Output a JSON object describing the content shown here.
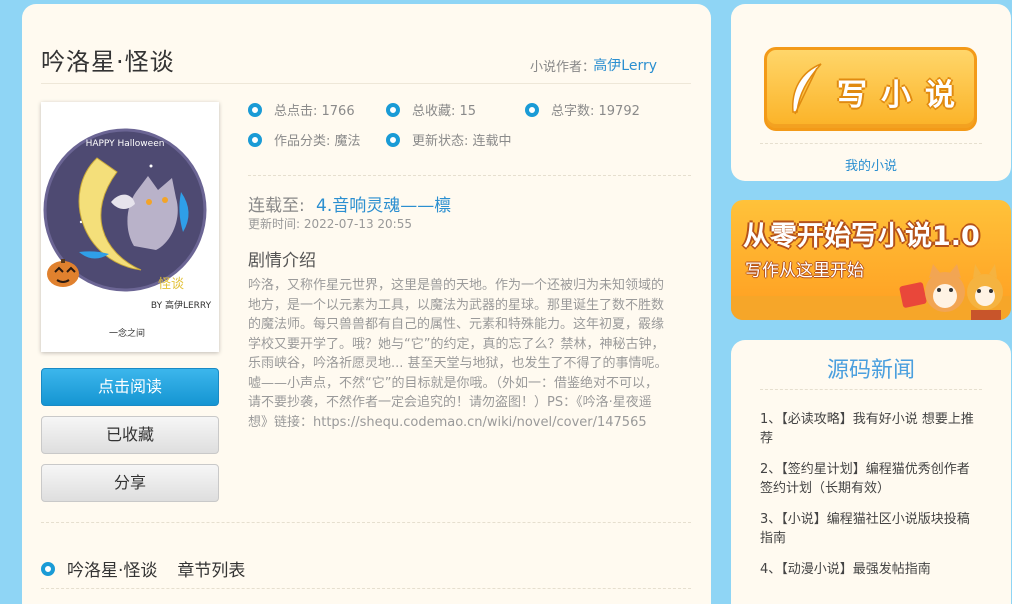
{
  "novel": {
    "title": "吟洛星·怪谈",
    "author_label": "小说作者：",
    "author_name": "高伊Lerry",
    "stats": {
      "clicks_label": "总点击: 1766",
      "favorites_label": "总收藏: 15",
      "words_label": "总字数: 19792",
      "category_label": "作品分类: 魔法",
      "status_label": "更新状态: 连载中"
    },
    "latest_label": "连载至:",
    "latest_chapter": "4.音响灵魂——檩",
    "update_time": "更新时间: 2022-07-13 20:55",
    "plot_heading": "剧情介绍",
    "plot_text": "吟洛，又称作星元世界，这里是兽的天地。作为一个还被归为未知领域的地方，是一个以元素为工具，以魔法为武器的星球。那里诞生了数不胜数的魔法师。每只兽兽都有自己的属性、元素和特殊能力。这年初夏，霰缘学校又要开学了。哦？她与“它”的约定，真的忘了么？禁林，神秘古钟，乐雨峡谷，吟洛祈愿灵地... 甚至天堂与地狱，也发生了不得了的事情呢。 嘘——小声点，不然“它”的目标就是你哦。（外如一：借鉴绝对不可以，请不要抄袭，不然作者一定会追究的！请勿盗图！）PS：《吟洛·星夜遥想》链接：https://shequ.codemao.cn/wiki/novel/cover/147565",
    "chapter_title": "吟洛星·怪谈",
    "chapter_list_label": "章节列表"
  },
  "cover": {
    "banner_text": "HAPPY Halloween",
    "title_text": "怪谈",
    "byline": "BY 高伊LERRY",
    "tagline": "一念之间"
  },
  "buttons": {
    "read": "点击阅读",
    "favorited": "已收藏",
    "share": "分享"
  },
  "sidebar": {
    "write_button": "写小说",
    "my_novels": "我的小说",
    "banner_title": "从零开始写小说1.0",
    "banner_subtitle": "写作从这里开始",
    "news_title": "源码新闻",
    "news": [
      "1、【必读攻略】我有好小说 想要上推荐",
      "2、【签约星计划】编程猫优秀创作者签约计划（长期有效）",
      "3、【小说】编程猫社区小说版块投稿指南",
      "4、【动漫小说】最强发帖指南"
    ]
  },
  "colors": {
    "background": "#8fd5f5",
    "card": "#fffaf0",
    "accent": "#1a9bd6",
    "link": "#2b8fd0"
  }
}
